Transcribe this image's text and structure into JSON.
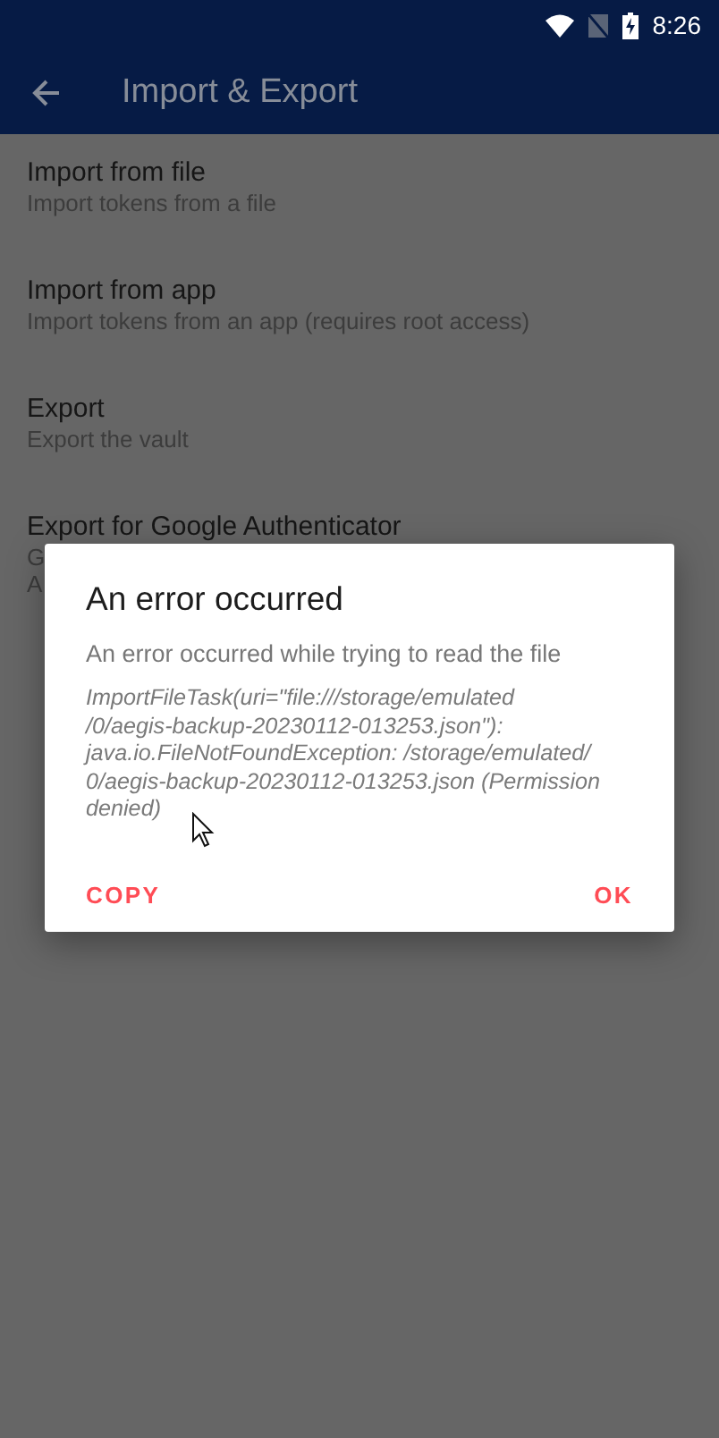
{
  "status_bar": {
    "time": "8:26"
  },
  "toolbar": {
    "title": "Import & Export"
  },
  "items": [
    {
      "title": "Import from file",
      "subtitle_lines": [
        "Import tokens from a file"
      ]
    },
    {
      "title": "Import from app",
      "subtitle_lines": [
        "Import tokens from an app (requires root access)"
      ]
    },
    {
      "title": "Export",
      "subtitle_lines": [
        "Export the vault"
      ]
    },
    {
      "title": "Export for Google Authenticator",
      "subtitle_lines": [
        "G",
        "A"
      ]
    }
  ],
  "dialog": {
    "title": "An error occurred",
    "message": "An error occurred while trying to read the file",
    "detail_lines": [
      "ImportFileTask(uri=\"file:///storage/emulated",
      "/0/aegis-backup-20230112-013253.json\"):",
      "java.io.FileNotFoundException: /storage/emulated/",
      "0/aegis-backup-20230112-013253.json (Permission",
      "denied)"
    ],
    "buttons": [
      "COPY",
      "OK"
    ]
  }
}
